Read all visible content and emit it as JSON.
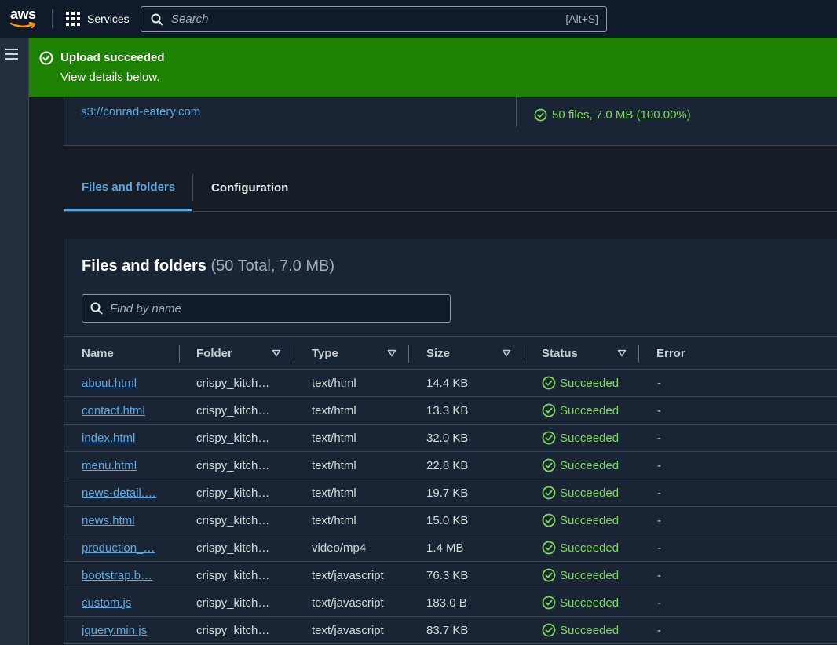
{
  "nav": {
    "logo_text": "aws",
    "services_label": "Services",
    "search_placeholder": "Search",
    "search_hotkey": "[Alt+S]"
  },
  "flash": {
    "title": "Upload succeeded",
    "message": "View details below."
  },
  "summary": {
    "destination": "s3://conrad-eatery.com",
    "succeeded": "50 files, 7.0 MB (100.00%)"
  },
  "tabs": [
    {
      "label": "Files and folders",
      "active": true
    },
    {
      "label": "Configuration",
      "active": false
    }
  ],
  "files": {
    "heading": "Files and folders",
    "counter": "(50 Total, 7.0 MB)",
    "find_placeholder": "Find by name",
    "columns": [
      "Name",
      "Folder",
      "Type",
      "Size",
      "Status",
      "Error"
    ],
    "rows": [
      {
        "name": "about.html",
        "folder": "crispy_kitch…",
        "type": "text/html",
        "size": "14.4 KB",
        "status": "Succeeded",
        "error": "-"
      },
      {
        "name": "contact.html",
        "folder": "crispy_kitch…",
        "type": "text/html",
        "size": "13.3 KB",
        "status": "Succeeded",
        "error": "-"
      },
      {
        "name": "index.html",
        "folder": "crispy_kitch…",
        "type": "text/html",
        "size": "32.0 KB",
        "status": "Succeeded",
        "error": "-"
      },
      {
        "name": "menu.html",
        "folder": "crispy_kitch…",
        "type": "text/html",
        "size": "22.8 KB",
        "status": "Succeeded",
        "error": "-"
      },
      {
        "name": "news-detail.…",
        "folder": "crispy_kitch…",
        "type": "text/html",
        "size": "19.7 KB",
        "status": "Succeeded",
        "error": "-"
      },
      {
        "name": "news.html",
        "folder": "crispy_kitch…",
        "type": "text/html",
        "size": "15.0 KB",
        "status": "Succeeded",
        "error": "-"
      },
      {
        "name": "production_…",
        "folder": "crispy_kitch…",
        "type": "video/mp4",
        "size": "1.4 MB",
        "status": "Succeeded",
        "error": "-"
      },
      {
        "name": "bootstrap.b…",
        "folder": "crispy_kitch…",
        "type": "text/javascript",
        "size": "76.3 KB",
        "status": "Succeeded",
        "error": "-"
      },
      {
        "name": "custom.js",
        "folder": "crispy_kitch…",
        "type": "text/javascript",
        "size": "183.0 B",
        "status": "Succeeded",
        "error": "-"
      },
      {
        "name": "jquery.min.js",
        "folder": "crispy_kitch…",
        "type": "text/javascript",
        "size": "83.7 KB",
        "status": "Succeeded",
        "error": "-"
      }
    ]
  },
  "icons": {
    "flash": "check-circle-icon",
    "status": "check-circle-icon",
    "search": "search-icon",
    "menu": "hamburger-icon",
    "services": "grid-icon",
    "sort": "caret-down-icon"
  },
  "colors": {
    "flash_bg": "#1d8102",
    "link": "#5fa9e0",
    "success": "#7ed957",
    "nav_bg": "#0f1b2a"
  }
}
